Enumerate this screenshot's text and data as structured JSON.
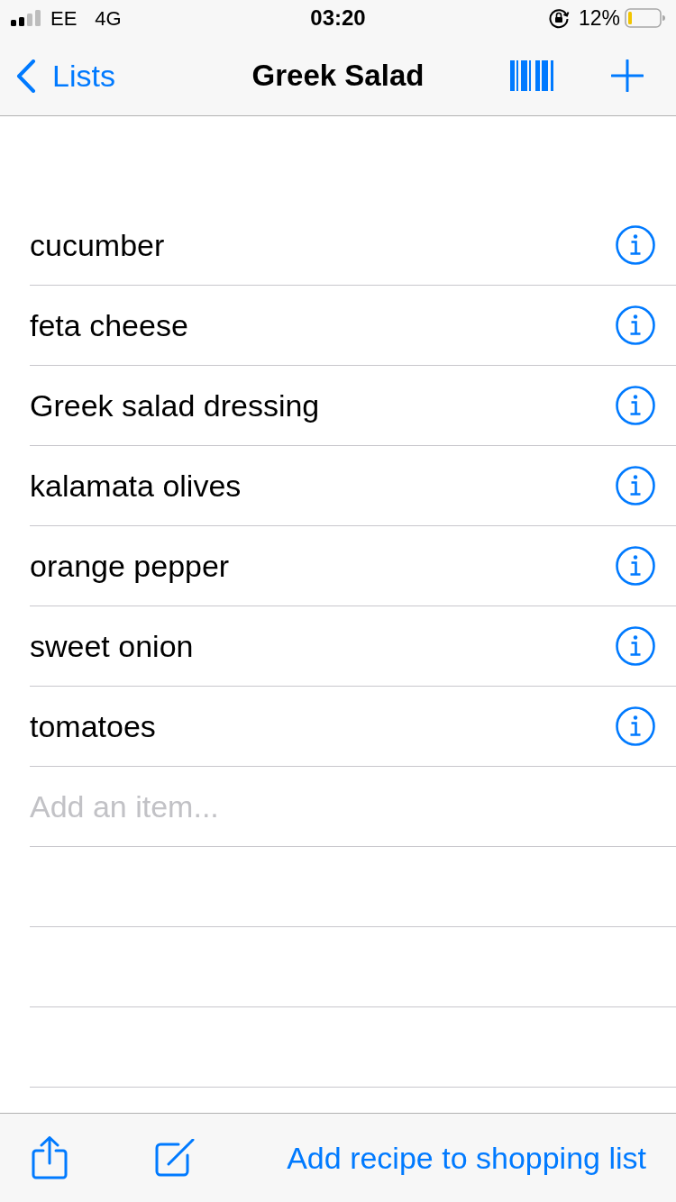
{
  "status_bar": {
    "carrier": "EE",
    "network": "4G",
    "time": "03:20",
    "battery_percent": "12%"
  },
  "nav_bar": {
    "back_label": "Lists",
    "title": "Greek Salad"
  },
  "items": [
    "cucumber",
    "feta cheese",
    "Greek salad dressing",
    "kalamata olives",
    "orange pepper",
    "sweet onion",
    "tomatoes"
  ],
  "add_item": {
    "placeholder": "Add an item..."
  },
  "toolbar": {
    "action_label": "Add recipe to shopping list"
  }
}
